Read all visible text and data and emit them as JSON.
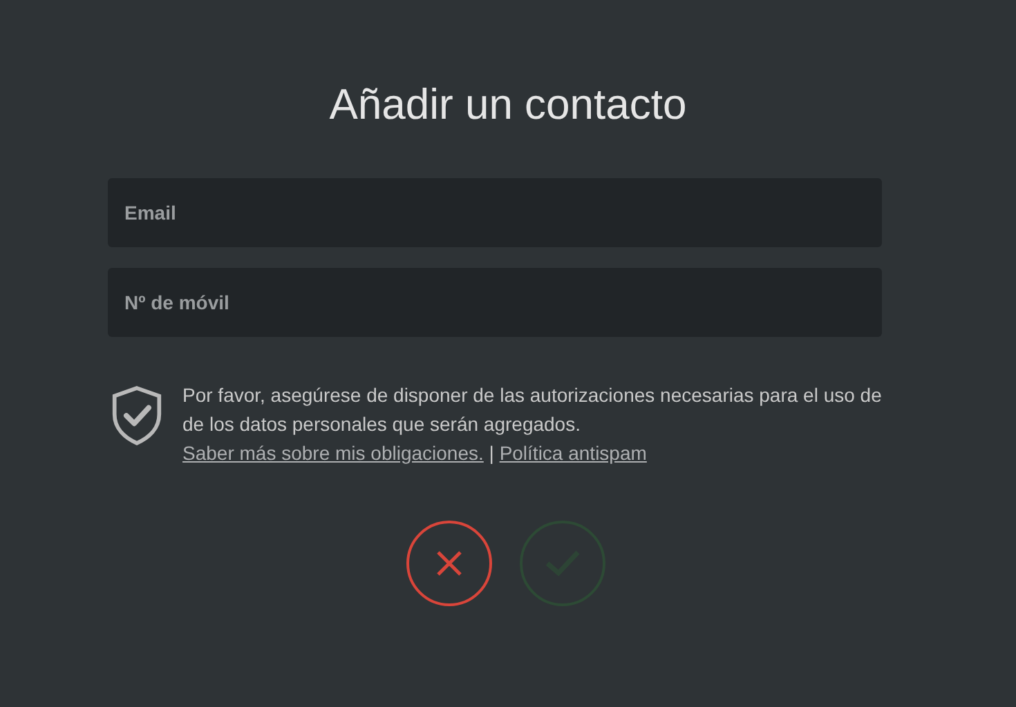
{
  "title": "Añadir un contacto",
  "fields": [
    {
      "placeholder": "Email"
    },
    {
      "placeholder": "Nº de móvil"
    }
  ],
  "notice": {
    "text": "Por favor, asegúrese de disponer de las autorizaciones necesarias para el uso de de los datos personales que serán agregados.",
    "links": [
      "Saber más sobre mis obligaciones.",
      "Política antispam"
    ],
    "separator": "|"
  },
  "buttons": [
    {
      "kind": "cancel",
      "disabled": false
    },
    {
      "kind": "confirm",
      "disabled": true
    }
  ]
}
